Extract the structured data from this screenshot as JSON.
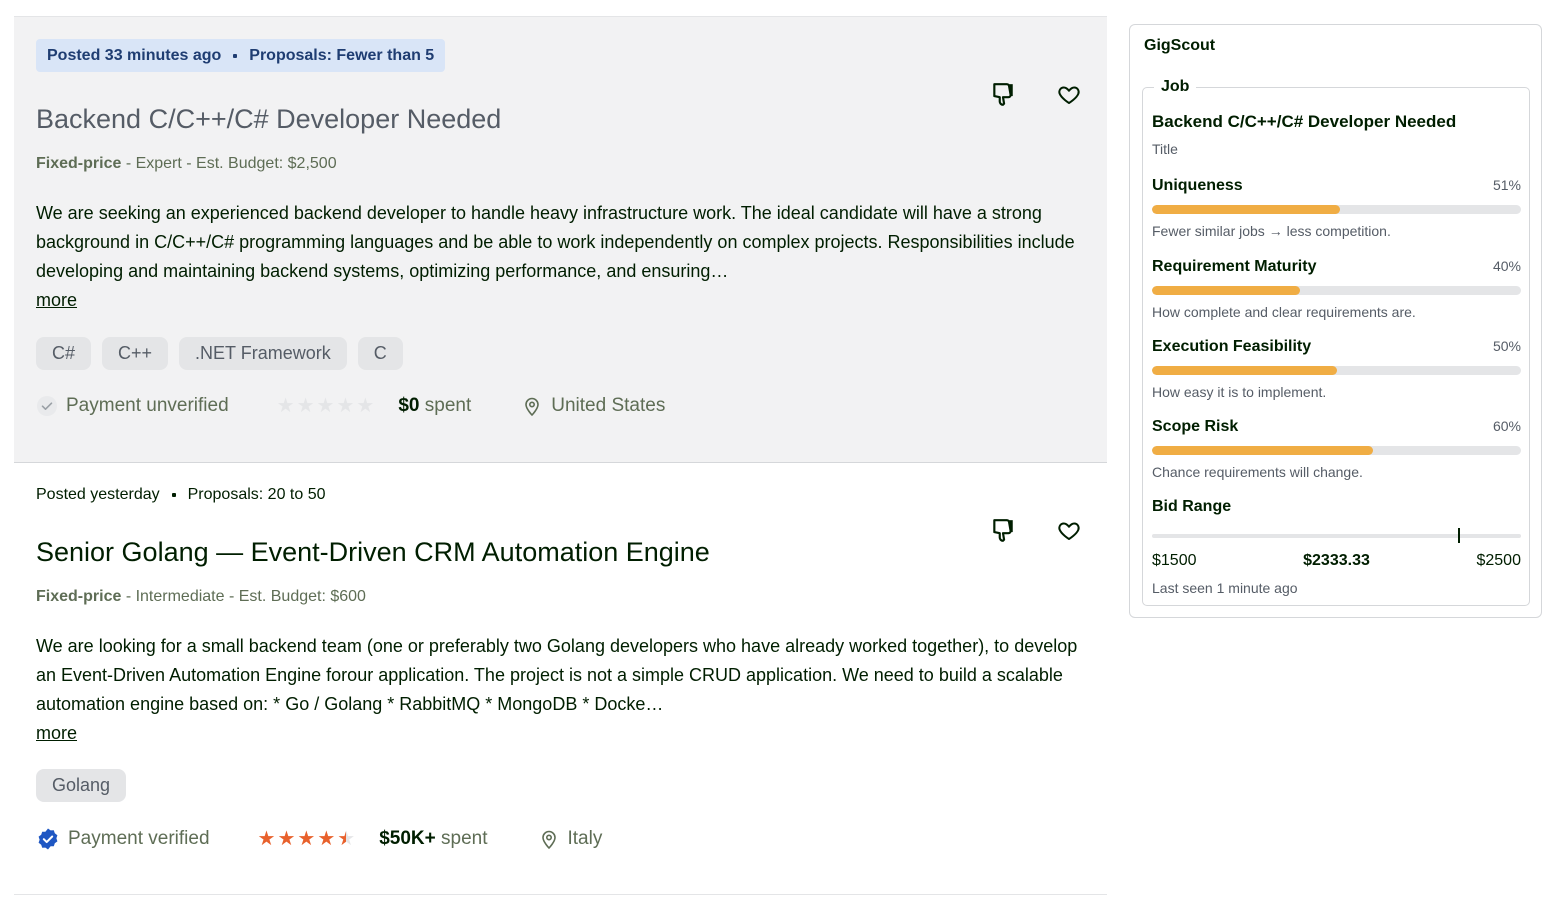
{
  "jobs": [
    {
      "posted": "Posted 33 minutes ago",
      "proposals": "Proposals: Fewer than 5",
      "title": "Backend C/C++/C# Developer Needed",
      "type": "Fixed-price",
      "details": "- Expert - Est. Budget: $2,500",
      "description": "We are seeking an experienced backend developer to handle heavy infrastructure work. The ideal candidate will have a strong background in C/C++/C# programming languages and be able to work independently on complex projects. Responsibilities include developing and maintaining backend systems, optimizing performance, and ensuring…",
      "more": "more",
      "tags": [
        "C#",
        "C++",
        ".NET Framework",
        "C"
      ],
      "payment": "Payment unverified",
      "rating": 0,
      "spent_amount": "$0",
      "spent_label": "spent",
      "location": "United States"
    },
    {
      "posted": "Posted yesterday",
      "proposals": "Proposals: 20 to 50",
      "title": "Senior Golang — Event-Driven CRM Automation Engine",
      "type": "Fixed-price",
      "details": "- Intermediate - Est. Budget: $600",
      "description": "We are looking for a small backend team (one or preferably two Golang developers who have already worked together), to develop an Event-Driven Automation Engine forour application. The project is not a simple CRUD application. We need to build a scalable automation engine based on: * Go / Golang * RabbitMQ * MongoDB * Docke…",
      "more": "more",
      "tags": [
        "Golang"
      ],
      "payment": "Payment verified",
      "rating": 4.5,
      "spent_amount": "$50K+",
      "spent_label": "spent",
      "location": "Italy"
    }
  ],
  "icons": {
    "dislike": "thumbs-down-icon",
    "save": "heart-icon",
    "unverified": "check-circle-icon",
    "verified": "verified-badge-icon",
    "location": "map-pin-icon",
    "star": "star-icon"
  },
  "colors": {
    "verified_blue": "#1f57c3",
    "star_orange": "#e8612c",
    "bar_orange": "#f0ad44",
    "highlight_bg": "#d9e5f7"
  },
  "panel": {
    "title": "GigScout",
    "legend": "Job",
    "job_title": "Backend C/C++/C# Developer Needed",
    "job_title_caption": "Title",
    "metrics": [
      {
        "name": "Uniqueness",
        "value": "51%",
        "fraction": 0.51,
        "desc": "Fewer similar jobs → less competition."
      },
      {
        "name": "Requirement Maturity",
        "value": "40%",
        "fraction": 0.4,
        "desc": "How complete and clear requirements are."
      },
      {
        "name": "Execution Feasibility",
        "value": "50%",
        "fraction": 0.5,
        "desc": "How easy it is to implement."
      },
      {
        "name": "Scope Risk",
        "value": "60%",
        "fraction": 0.6,
        "desc": "Chance requirements will change."
      }
    ],
    "bid": {
      "label": "Bid Range",
      "min": "$1500",
      "value": "$2333.33",
      "max": "$2500",
      "min_num": 1500,
      "value_num": 2333.33,
      "max_num": 2500
    },
    "last_seen": "Last seen 1 minute ago"
  }
}
